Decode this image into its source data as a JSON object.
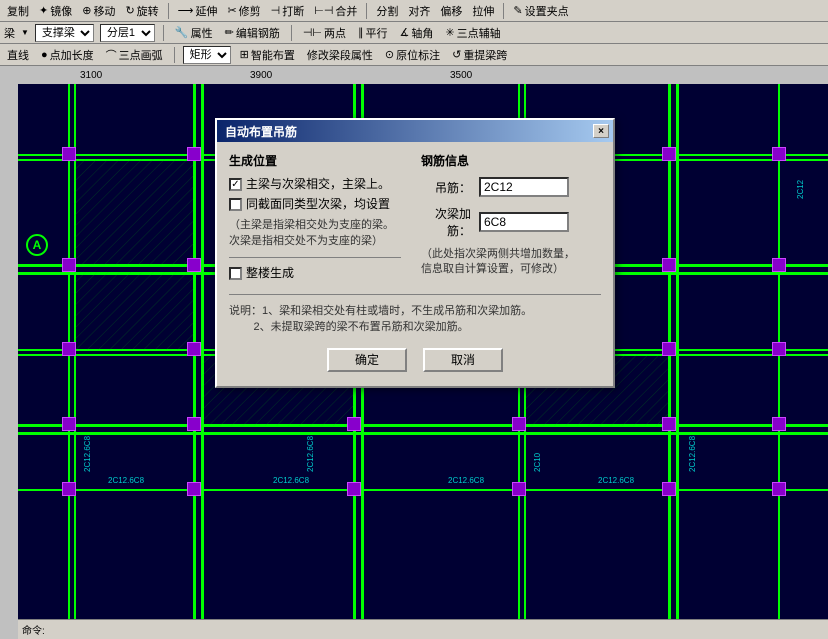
{
  "toolbar1": {
    "items": [
      "复制",
      "镜像",
      "移动",
      "旋转",
      "延伸",
      "修剪",
      "打断",
      "合并",
      "分割",
      "对齐",
      "偏移",
      "拉伸",
      "设置夹点"
    ]
  },
  "toolbar2": {
    "type_label": "梁",
    "type_select": "支撑梁",
    "layer_select": "分层1",
    "btn1": "属性",
    "btn2": "编辑钢筋",
    "btn3": "两点",
    "btn4": "平行",
    "btn5": "轴角",
    "btn6": "三点辅轴"
  },
  "toolbar3": {
    "btn1": "直线",
    "btn2": "点加长度",
    "btn3": "三点画弧",
    "shape_select": "矩形",
    "btn4": "智能布置",
    "btn5": "修改梁段属性",
    "btn6": "原位标注",
    "btn7": "重提梁跨"
  },
  "scale_marks": [
    "3100",
    "3900",
    "3500"
  ],
  "dialog": {
    "title": "自动布置吊筋",
    "close_btn": "×",
    "section_generate": "生成位置",
    "checkbox1": {
      "label": "主梁与次梁相交，主梁上。",
      "checked": true
    },
    "checkbox2": {
      "label": "同截面同类型次梁，均设置",
      "checked": false
    },
    "note1": "（主梁是指梁相交处为支座的梁。\n次梁是指相交处不为支座的梁）",
    "checkbox3": {
      "label": "整楼生成",
      "checked": false
    },
    "section_rebar": "钢筋信息",
    "rebar1_label": "吊筋：",
    "rebar1_value": "2C12",
    "rebar2_label": "次梁加筋：",
    "rebar2_value": "6C8",
    "rebar_note": "（此处指次梁两侧共增加数量，\n信息取自计算设置，可修改）",
    "explain_title": "说明：",
    "explain_text": "1、梁和梁相交处有柱或墙时，不生成吊筋和次梁加筋。\n    2、未提取梁跨的梁不布置吊筋和次梁加筋。",
    "btn_ok": "确定",
    "btn_cancel": "取消"
  },
  "drawing": {
    "col_label": "A",
    "beam_labels": [
      "2C12.6C8",
      "2C12.6C8",
      "2C12.6C8",
      "2C12.6C8"
    ],
    "vert_labels": [
      "2C12.6C8",
      "2C10",
      "2C12.6C8"
    ]
  }
}
